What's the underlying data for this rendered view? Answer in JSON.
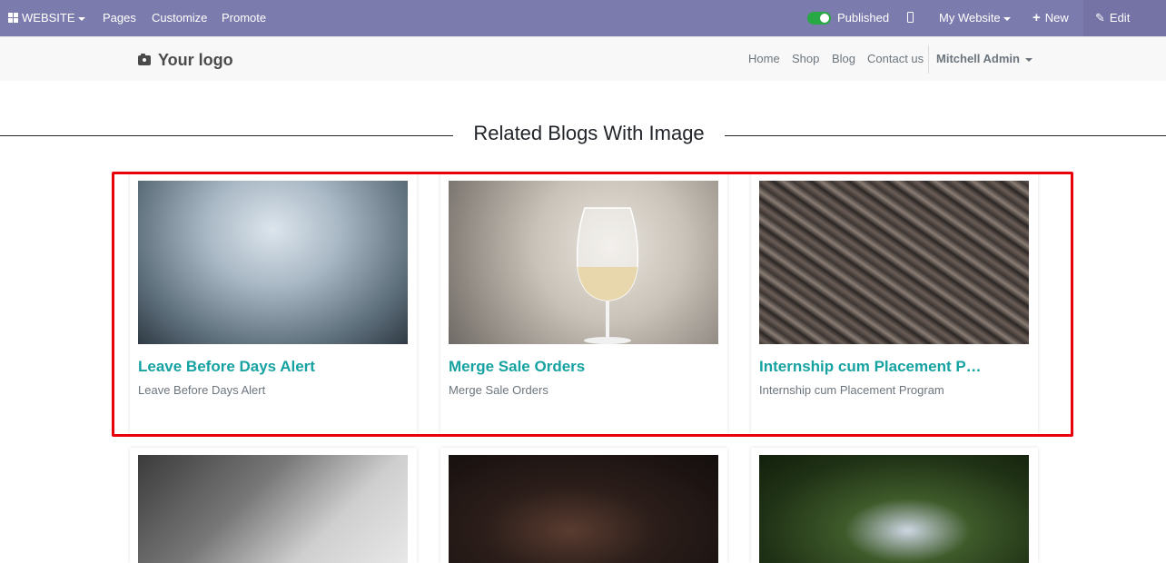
{
  "admin_bar": {
    "website_label": "WEBSITE",
    "pages_label": "Pages",
    "customize_label": "Customize",
    "promote_label": "Promote",
    "published_label": "Published",
    "my_website_label": "My Website",
    "new_label": "New",
    "edit_label": "Edit",
    "bar_color": "#7c7bad"
  },
  "header": {
    "logo_text": "Your logo",
    "nav": [
      "Home",
      "Shop",
      "Blog",
      "Contact us"
    ],
    "user_name": "Mitchell Admin"
  },
  "section": {
    "title": "Related Blogs With Image"
  },
  "blogs": [
    {
      "title": "Leave Before Days Alert",
      "description": "Leave Before Days Alert"
    },
    {
      "title": "Merge Sale Orders",
      "description": "Merge Sale Orders"
    },
    {
      "title": "Internship cum Placement P…",
      "description": "Internship cum Placement Program"
    }
  ],
  "accent_color": "#17a2a2",
  "highlight_color": "#e8000b"
}
